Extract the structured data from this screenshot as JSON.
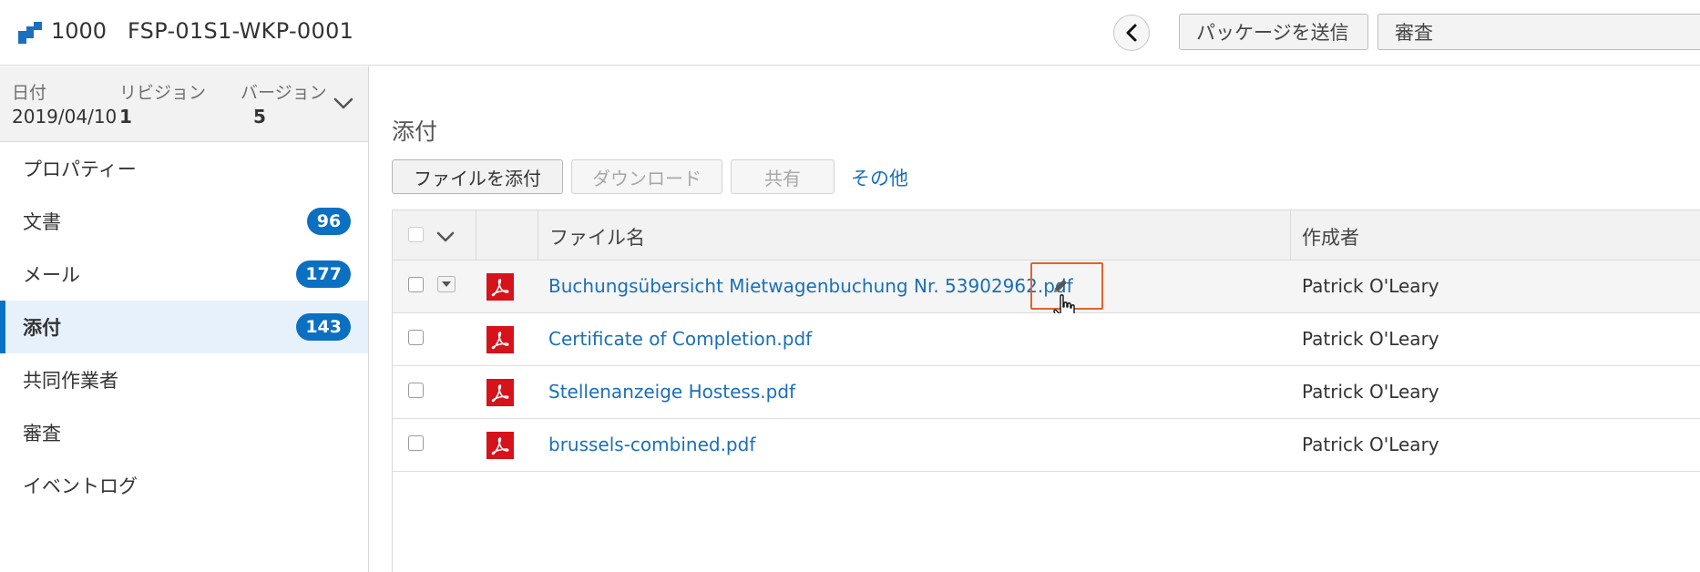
{
  "header": {
    "number": "1000",
    "title": "FSP-01S1-WKP-0001",
    "buttons": [
      "パッケージを送信",
      "審査"
    ]
  },
  "sidebar": {
    "meta": {
      "date_label": "日付",
      "date_value": "2019/04/10",
      "revision_label": "リビジョン",
      "revision_value": "1",
      "version_label": "バージョン",
      "version_value": "5"
    },
    "items": [
      {
        "label": "プロパティー",
        "count": null
      },
      {
        "label": "文書",
        "count": "96"
      },
      {
        "label": "メール",
        "count": "177"
      },
      {
        "label": "添付",
        "count": "143",
        "active": true
      },
      {
        "label": "共同作業者",
        "count": null
      },
      {
        "label": "審査",
        "count": null
      },
      {
        "label": "イベントログ",
        "count": null
      }
    ]
  },
  "main": {
    "title": "添付",
    "toolbar": {
      "attach": "ファイルを添付",
      "download": "ダウンロード",
      "share": "共有",
      "more": "その他"
    },
    "table": {
      "columns": [
        "ファイル名",
        "作成者"
      ],
      "rows": [
        {
          "name": "Buchungsübersicht Mietwagenbuchung Nr. 53902962.pdf",
          "author": "Patrick O'Leary"
        },
        {
          "name": "Certificate of Completion.pdf",
          "author": "Patrick O'Leary"
        },
        {
          "name": "Stellenanzeige Hostess.pdf",
          "author": "Patrick O'Leary"
        },
        {
          "name": "brussels-combined.pdf",
          "author": "Patrick O'Leary"
        }
      ]
    }
  },
  "colors": {
    "accent": "#0b6fc2",
    "link": "#1a6fb8",
    "pdf": "#d6121b",
    "highlight": "#e0632e"
  }
}
